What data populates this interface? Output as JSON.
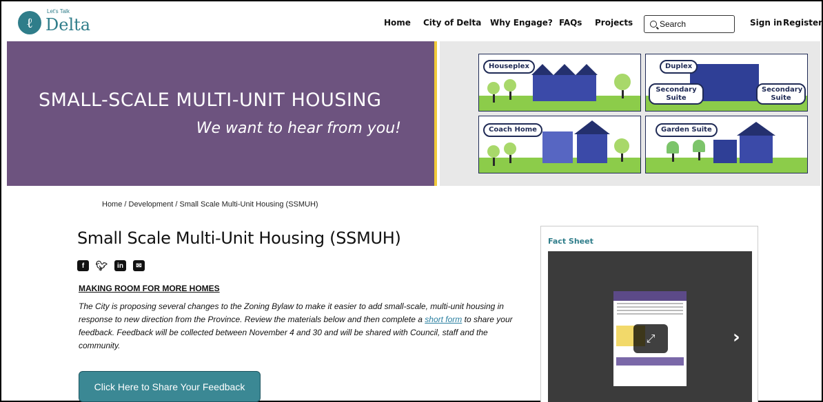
{
  "header": {
    "logo_small": "Let's Talk",
    "logo_big": "Delta",
    "nav": [
      "Home",
      "City of Delta",
      "Why Engage?",
      "FAQs",
      "Projects"
    ],
    "search_placeholder": "Search",
    "sign_in": "Sign in",
    "register": "Register"
  },
  "banner": {
    "title": "SMALL-SCALE MULTI-UNIT HOUSING",
    "subtitle": "We want to hear from you!",
    "tiles": {
      "houseplex": "Houseplex",
      "duplex": "Duplex",
      "secondary_suite_left": "Secondary Suite",
      "secondary_suite_right": "Secondary Suite",
      "coach_home": "Coach Home",
      "garden_suite": "Garden Suite"
    }
  },
  "breadcrumb": "Home  /  Development  /  Small Scale Multi-Unit Housing (SSMUH)",
  "main": {
    "title": "Small Scale Multi-Unit Housing (SSMUH)",
    "section_heading": "MAKING ROOM FOR MORE HOMES",
    "body_part1": "The City is proposing several changes to the Zoning Bylaw to make it easier to add small-scale, multi-unit housing in response to new direction from the Province. Review the materials below and then complete a ",
    "body_link": "short form",
    "body_part2": " to share your feedback. Feedback will be collected between November 4 and 30 and will be shared with Council, staff and the community.",
    "cta_label": "Click Here to Share Your Feedback"
  },
  "fact_sheet": {
    "title": "Fact Sheet"
  },
  "colors": {
    "brand_teal": "#2f7d8a",
    "banner_purple": "#6d537f",
    "accent_yellow": "#f0c93a",
    "cta_teal": "#3b8894"
  }
}
